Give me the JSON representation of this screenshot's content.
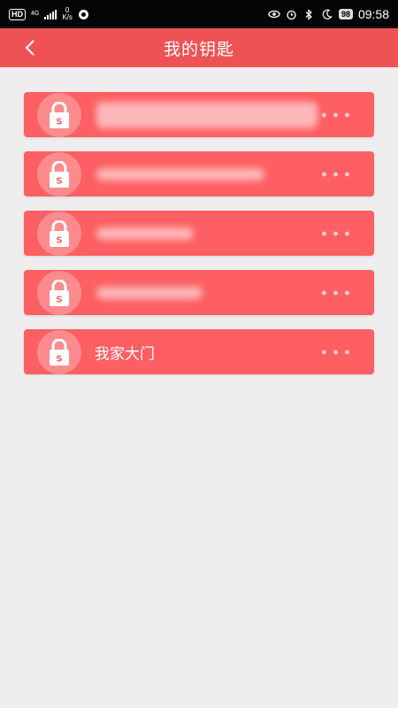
{
  "status_bar": {
    "hd_label": "HD",
    "network_label": "4G",
    "speed_value": "0",
    "speed_unit": "K/s",
    "battery": "98",
    "time": "09:58"
  },
  "header": {
    "title": "我的钥匙"
  },
  "keys": [
    {
      "name": "",
      "redacted": true
    },
    {
      "name": "",
      "redacted": true
    },
    {
      "name": "",
      "redacted": true
    },
    {
      "name": "",
      "redacted": true
    },
    {
      "name": "我家大门",
      "redacted": false
    }
  ],
  "colors": {
    "header_bg": "#ef5254",
    "card_bg": "#fd5f62",
    "page_bg": "#efedee"
  }
}
